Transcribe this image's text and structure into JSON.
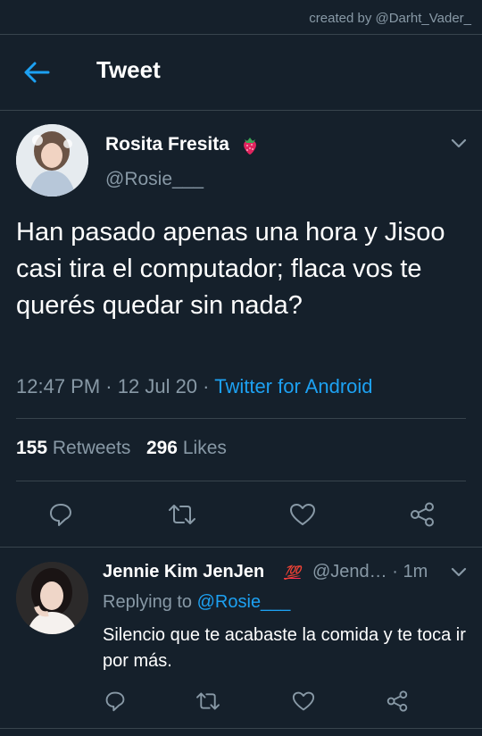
{
  "credit": "created by @Darht_Vader_",
  "header": {
    "title": "Tweet"
  },
  "tweet": {
    "author_name": "Rosita Fresita",
    "author_handle": "@Rosie___",
    "text": "Han pasado apenas una hora y Jisoo casi tira el computador; flaca vos te querés quedar sin nada?",
    "time": "12:47 PM",
    "date": "12 Jul 20",
    "separator": "·",
    "source": "Twitter for Android",
    "retweets_count": "155",
    "retweets_label": "Retweets",
    "likes_count": "296",
    "likes_label": "Likes"
  },
  "reply": {
    "author_name": "Jennie Kim JenJen",
    "author_handle_time": "@Jend… · 1m",
    "badge": "💯",
    "replying_prefix": "Replying to",
    "replying_to": "@Rosie___",
    "text": "Silencio que te acabaste la comida y te toca ir por más."
  },
  "colors": {
    "background": "#15202b",
    "accent": "#1da1f2",
    "muted": "#8899a6",
    "divider": "#38444d"
  },
  "icons": [
    "back-arrow-icon",
    "strawberry-icon",
    "chevron-down-icon",
    "reply-icon",
    "retweet-icon",
    "like-icon",
    "share-icon"
  ]
}
